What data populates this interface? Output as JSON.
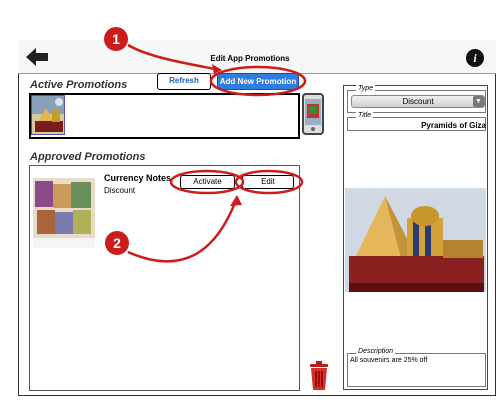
{
  "header": {
    "title": "Edit App Promotions",
    "back_icon": "back-arrow-icon",
    "info_icon": "info-icon",
    "info_glyph": "i"
  },
  "active": {
    "section_label": "Active Promotions",
    "refresh_label": "Refresh",
    "add_label": "Add New Promotion",
    "preview_icon": "phone-preview-icon"
  },
  "approved": {
    "section_label": "Approved Promotions",
    "items": [
      {
        "title": "Currency Notes",
        "type": "Discount",
        "activate_label": "Activate",
        "edit_label": "Edit"
      }
    ]
  },
  "detail": {
    "type_legend": "Type",
    "type_value": "Discount",
    "title_legend": "Title",
    "title_value": "Pyramids of Giza",
    "description_legend": "Description",
    "description_value": "All souvenirs are 25% off"
  },
  "annotations": {
    "step1": "1",
    "step2": "2"
  },
  "colors": {
    "accent_blue": "#2f7de0",
    "annotation_red": "#cc1d1d",
    "panel_border": "#3b3b9a"
  }
}
